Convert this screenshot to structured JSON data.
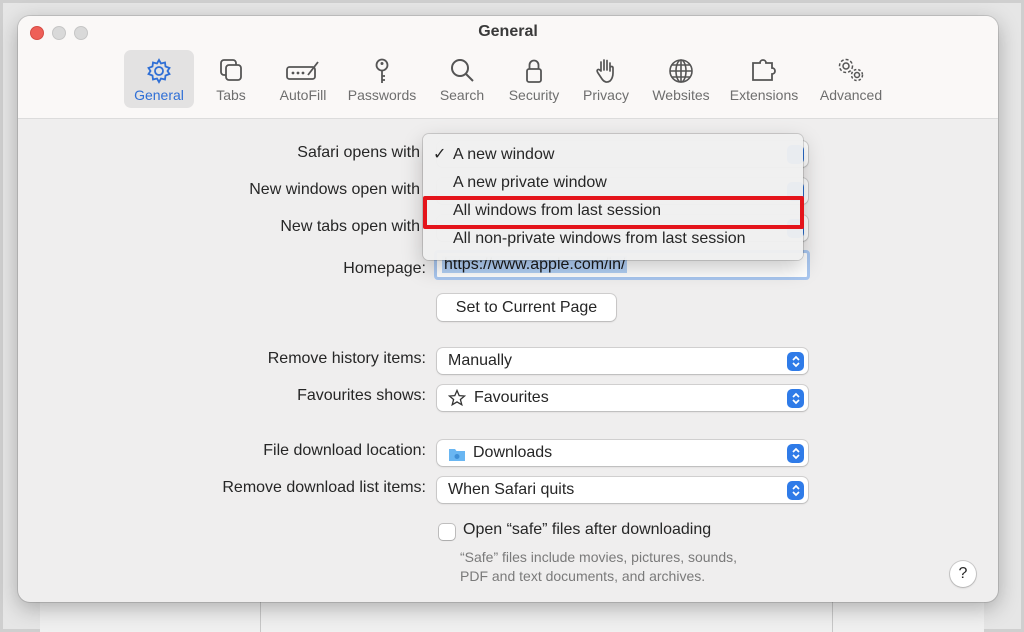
{
  "window": {
    "title": "General"
  },
  "toolbar": {
    "items": [
      {
        "label": "General",
        "icon": "gear-icon",
        "active": true
      },
      {
        "label": "Tabs",
        "icon": "tabs-icon"
      },
      {
        "label": "AutoFill",
        "icon": "autofill-icon"
      },
      {
        "label": "Passwords",
        "icon": "key-icon"
      },
      {
        "label": "Search",
        "icon": "magnifier-icon"
      },
      {
        "label": "Security",
        "icon": "lock-icon"
      },
      {
        "label": "Privacy",
        "icon": "hand-icon"
      },
      {
        "label": "Websites",
        "icon": "globe-icon"
      },
      {
        "label": "Extensions",
        "icon": "puzzle-icon"
      },
      {
        "label": "Advanced",
        "icon": "gears-icon"
      }
    ]
  },
  "settings": {
    "safari_opens_with_label": "Safari opens with",
    "new_windows_label": "New windows open with",
    "new_tabs_label": "New tabs open with",
    "homepage_label": "Homepage:",
    "homepage_value": "https://www.apple.com/in/",
    "set_current_page": "Set to Current Page",
    "remove_history_label": "Remove history items:",
    "remove_history_value": "Manually",
    "favourites_label": "Favourites shows:",
    "favourites_value": "Favourites",
    "download_location_label": "File download location:",
    "download_location_value": "Downloads",
    "remove_download_label": "Remove download list items:",
    "remove_download_value": "When Safari quits",
    "open_safe_files_label": "Open “safe” files after downloading",
    "open_safe_files_checked": false,
    "safe_note_line1": "“Safe” files include movies, pictures, sounds,",
    "safe_note_line2": "PDF and text documents, and archives.",
    "help": "?"
  },
  "menu": {
    "checkmark": "✓",
    "items": [
      {
        "label": "A new window",
        "checked": true
      },
      {
        "label": "A new private window",
        "checked": false
      },
      {
        "label": "All windows from last session",
        "checked": false,
        "highlighted": true
      },
      {
        "label": "All non-private windows from last session",
        "checked": false
      }
    ]
  },
  "colors": {
    "accent": "#2f7be8",
    "highlight_box": "#e4141b",
    "close": "#ee5f58"
  }
}
